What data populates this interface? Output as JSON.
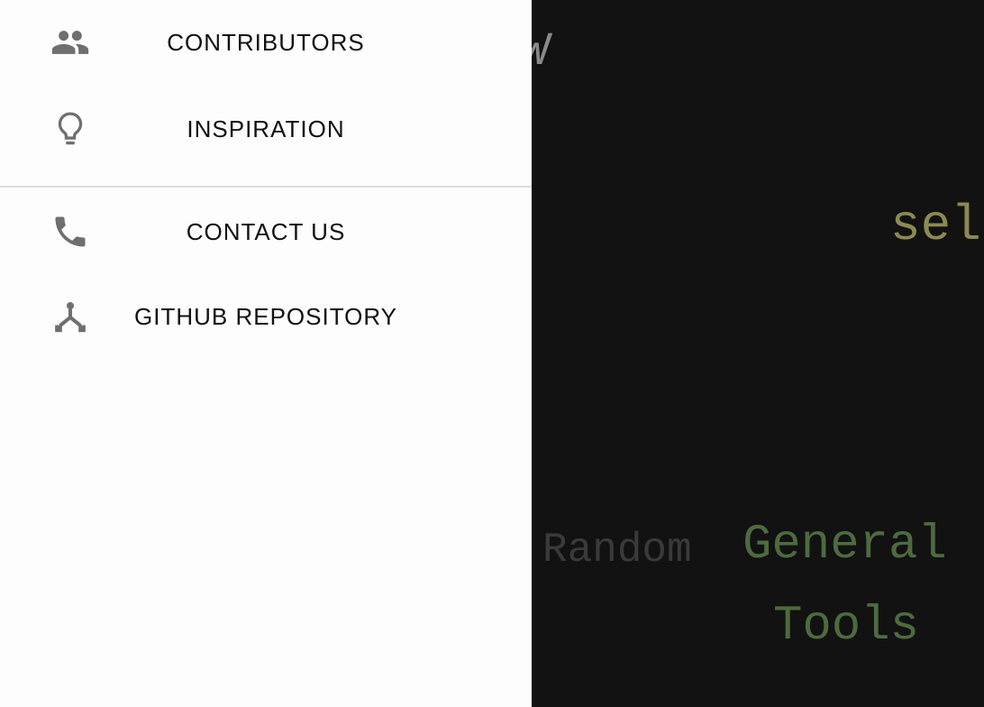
{
  "drawer": {
    "items": [
      {
        "label": "CONTRIBUTORS",
        "icon": "people-icon"
      },
      {
        "label": "INSPIRATION",
        "icon": "lightbulb-icon"
      },
      {
        "label": "CONTACT US",
        "icon": "phone-icon"
      },
      {
        "label": "GITHUB REPOSITORY",
        "icon": "fork-icon"
      }
    ]
  },
  "background": {
    "cut_glyph": "W",
    "select_fragment": "sel",
    "tags": [
      "Random",
      "General",
      "Tools"
    ]
  },
  "colors": {
    "drawer_bg": "#fdfdfd",
    "page_bg": "#121212",
    "icon": "#6f6f6f",
    "divider": "#dcdcdc",
    "select_text": "#8c8a52",
    "tag_green": "#4d6b3f",
    "tag_gray": "#3a3a3a"
  }
}
